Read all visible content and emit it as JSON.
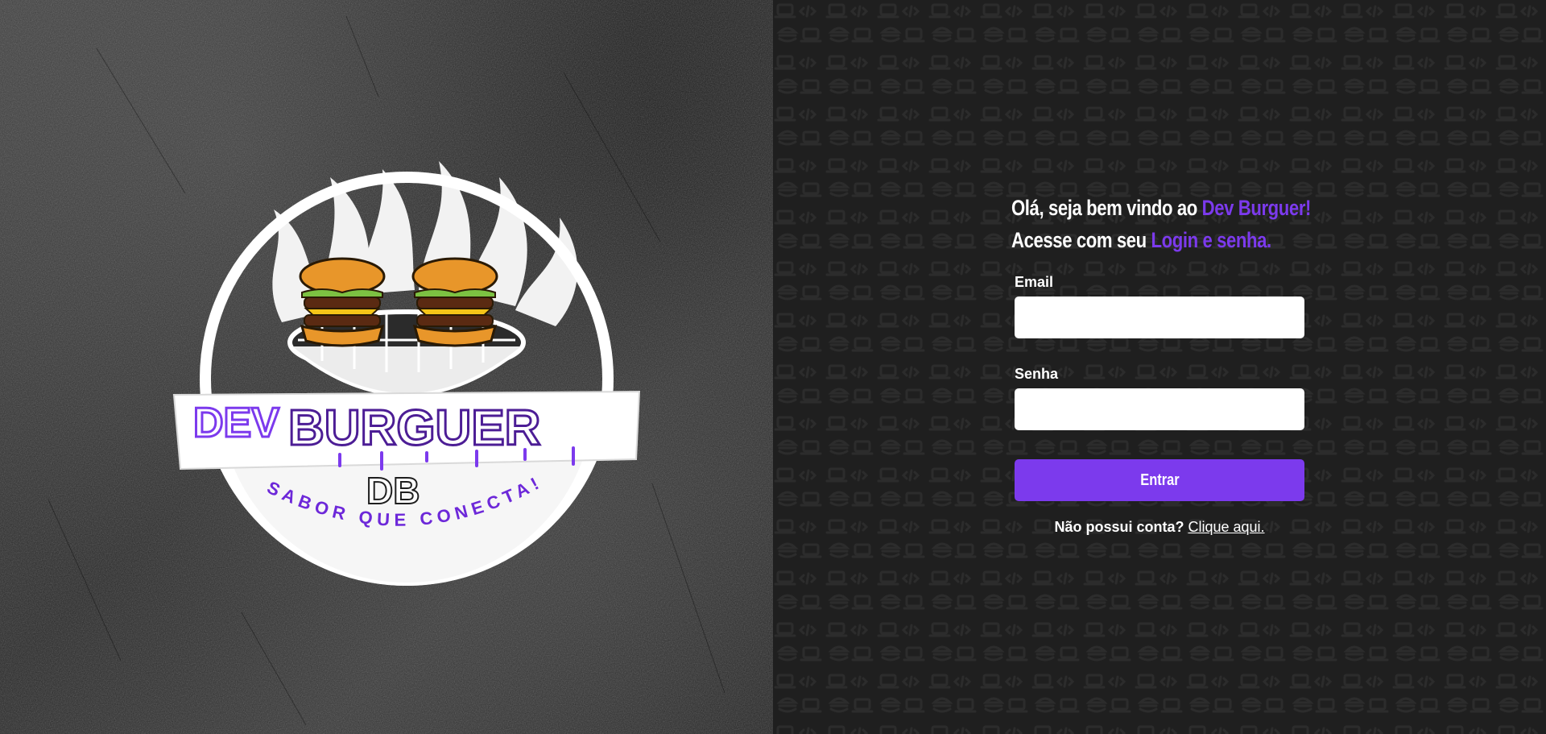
{
  "brand": {
    "logo_top": "DEV",
    "logo_main": "BURGUER",
    "logo_initials": "DB",
    "logo_slogan": "SABOR QUE CONECTA!"
  },
  "welcome": {
    "line1_prefix": "Olá, seja bem vindo ao ",
    "line1_highlight": "Dev Burguer!",
    "line2_prefix": "Acesse com seu ",
    "line2_highlight": "Login e senha."
  },
  "form": {
    "email_label": "Email",
    "email_value": "",
    "password_label": "Senha",
    "password_value": "",
    "submit_label": "Entrar"
  },
  "signup": {
    "question": "Não possui conta?",
    "link_label": "Clique aqui."
  },
  "colors": {
    "accent": "#7c3aed",
    "left_bg": "#2c2c2c",
    "right_bg": "#1f1f1f",
    "input_bg": "#ffffff",
    "text": "#ffffff"
  },
  "icons": [
    "burger-icon",
    "laptop-icon",
    "code-icon",
    "flame-icon",
    "grill-icon"
  ]
}
